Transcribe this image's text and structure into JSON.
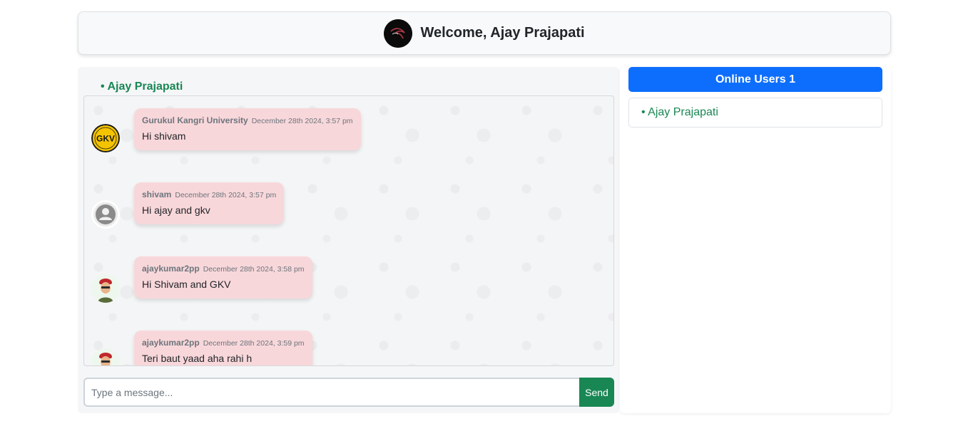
{
  "header": {
    "welcome": "Welcome, Ajay Prajapati",
    "avatar_icon": "kali-dragon-icon"
  },
  "chat": {
    "current_user": "• Ajay Prajapati",
    "messages": [
      {
        "sender": "Gurukul Kangri University",
        "time": "December 28th 2024, 3:57 pm",
        "text": "Hi shivam",
        "avatar": "gkv-logo",
        "avatar_text": "GKV"
      },
      {
        "sender": "shivam",
        "time": "December 28th 2024, 3:57 pm",
        "text": "Hi ajay and gkv",
        "avatar": "default-user-icon"
      },
      {
        "sender": "ajaykumar2pp",
        "time": "December 28th 2024, 3:58 pm",
        "text": "Hi Shivam and GKV",
        "avatar": "cartoon-avatar"
      },
      {
        "sender": "ajaykumar2pp",
        "time": "December 28th 2024, 3:59 pm",
        "text": "Teri baut yaad aha rahi h",
        "avatar": "cartoon-avatar"
      }
    ],
    "input_placeholder": "Type a message...",
    "input_value": "",
    "send_label": "Send"
  },
  "online": {
    "title": "Online Users 1",
    "users": [
      "• Ajay Prajapati"
    ]
  },
  "colors": {
    "bubble": "#f8d7da",
    "send_button": "#198754",
    "online_header": "#0d6efd",
    "online_text": "#198754"
  }
}
